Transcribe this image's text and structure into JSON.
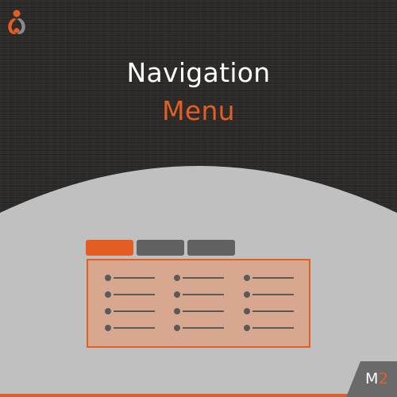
{
  "title": {
    "line1": "Navigation",
    "line2": "Menu"
  },
  "badge": {
    "prefix": "M",
    "number": "2"
  },
  "colors": {
    "accent": "#e45e24",
    "background_dark": "#2b2a28",
    "background_light": "#c0c0c0",
    "tab_inactive": "#616161",
    "panel_fill": "#d7a790"
  },
  "logo": {
    "icon": "brand-logo-icon"
  },
  "tabs": [
    {
      "state": "active"
    },
    {
      "state": "inactive"
    },
    {
      "state": "inactive"
    }
  ],
  "menu_items_per_column": 4,
  "menu_columns": 3
}
